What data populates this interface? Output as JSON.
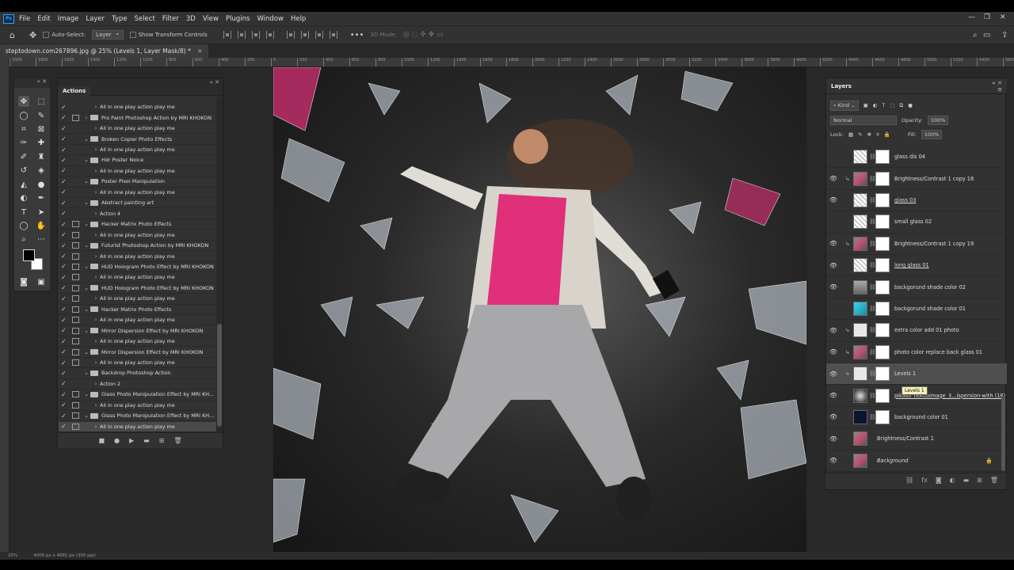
{
  "menubar": {
    "logo": "Ps",
    "items": [
      "File",
      "Edit",
      "Image",
      "Layer",
      "Type",
      "Select",
      "Filter",
      "3D",
      "View",
      "Plugins",
      "Window",
      "Help"
    ],
    "window_controls": [
      "—",
      "❐",
      "✕"
    ]
  },
  "options": {
    "auto_select_label": "Auto-Select:",
    "auto_select_value": "Layer",
    "transform_label": "Show Transform Controls",
    "mode_label": "3D Mode:"
  },
  "document": {
    "tab_title": "steptodown.com267896.jpg @ 25% (Levels 1, Layer Mask/8) *",
    "zoom": "25%",
    "size_info": "4000 px x 4881 px (300 ppi)"
  },
  "ruler_ticks": [
    "2000",
    "1800",
    "1600",
    "1400",
    "1200",
    "1000",
    "800",
    "600",
    "400",
    "200",
    "0",
    "200",
    "400",
    "600",
    "800",
    "1000",
    "1200",
    "1400",
    "1600",
    "1800",
    "2000",
    "2200",
    "2400",
    "2600",
    "2800",
    "3000",
    "3200",
    "3400",
    "3600",
    "3800",
    "4000",
    "4200",
    "4400",
    "4600",
    "4800",
    "5000",
    "5200",
    "5400",
    "5600",
    "5800",
    "6000"
  ],
  "actions_panel": {
    "tab_label": "Actions",
    "rows": [
      {
        "check": true,
        "dialog": false,
        "arrow": "›",
        "folder": false,
        "indent": true,
        "label": "All in one play action play me"
      },
      {
        "check": true,
        "dialog": true,
        "arrow": "›",
        "folder": true,
        "indent": false,
        "label": "Pro Paint Photoshop Action by MRI KHOKON"
      },
      {
        "check": true,
        "dialog": false,
        "arrow": "›",
        "folder": false,
        "indent": true,
        "label": "All in one play action play me"
      },
      {
        "check": true,
        "dialog": false,
        "arrow": "⌄",
        "folder": true,
        "indent": false,
        "label": "Broken Copier Photo Effects"
      },
      {
        "check": true,
        "dialog": false,
        "arrow": "›",
        "folder": false,
        "indent": true,
        "label": "All in one play action play me"
      },
      {
        "check": true,
        "dialog": false,
        "arrow": "⌄",
        "folder": true,
        "indent": false,
        "label": "Hdr Poster Noice"
      },
      {
        "check": true,
        "dialog": false,
        "arrow": "›",
        "folder": false,
        "indent": true,
        "label": "All in one play action play me"
      },
      {
        "check": true,
        "dialog": false,
        "arrow": "⌄",
        "folder": true,
        "indent": false,
        "label": "Poster Pixel Manipulation"
      },
      {
        "check": true,
        "dialog": false,
        "arrow": "›",
        "folder": false,
        "indent": true,
        "label": "All in one play action play me"
      },
      {
        "check": true,
        "dialog": false,
        "arrow": "⌄",
        "folder": true,
        "indent": false,
        "label": "Abstract painting art"
      },
      {
        "check": true,
        "dialog": false,
        "arrow": "›",
        "folder": false,
        "indent": true,
        "label": "Action 4"
      },
      {
        "check": true,
        "dialog": true,
        "arrow": "⌄",
        "folder": true,
        "indent": false,
        "label": "Hacker Matrix Photo Effects"
      },
      {
        "check": true,
        "dialog": true,
        "arrow": "›",
        "folder": false,
        "indent": true,
        "label": "All in one play action play me"
      },
      {
        "check": true,
        "dialog": true,
        "arrow": "⌄",
        "folder": true,
        "indent": false,
        "label": "Futurist Photoshop Action by MRI KHOKON"
      },
      {
        "check": true,
        "dialog": true,
        "arrow": "›",
        "folder": false,
        "indent": true,
        "label": "All in one play action play me"
      },
      {
        "check": true,
        "dialog": true,
        "arrow": "⌄",
        "folder": true,
        "indent": false,
        "label": "HUD Hologram Photo Effect by MRI KHOKON"
      },
      {
        "check": true,
        "dialog": true,
        "arrow": "›",
        "folder": false,
        "indent": true,
        "label": "All in one play action play me"
      },
      {
        "check": true,
        "dialog": true,
        "arrow": "⌄",
        "folder": true,
        "indent": false,
        "label": "HUD Hologram Photo Effect by MRI KHOKON"
      },
      {
        "check": true,
        "dialog": true,
        "arrow": "›",
        "folder": false,
        "indent": true,
        "label": "All in one play action play me"
      },
      {
        "check": true,
        "dialog": true,
        "arrow": "⌄",
        "folder": true,
        "indent": false,
        "label": "Hacker Matrix Photo Effects"
      },
      {
        "check": true,
        "dialog": true,
        "arrow": "›",
        "folder": false,
        "indent": true,
        "label": "All in one play action play me"
      },
      {
        "check": true,
        "dialog": true,
        "arrow": "⌄",
        "folder": true,
        "indent": false,
        "label": "Mirror Dispersion Effect by MRI KHOKON"
      },
      {
        "check": true,
        "dialog": true,
        "arrow": "›",
        "folder": false,
        "indent": true,
        "label": "All in one play action play me"
      },
      {
        "check": true,
        "dialog": true,
        "arrow": "⌄",
        "folder": true,
        "indent": false,
        "label": "Mirror Dispersion Effect by MRI KHOKON"
      },
      {
        "check": true,
        "dialog": true,
        "arrow": "›",
        "folder": false,
        "indent": true,
        "label": "All in one play action play me"
      },
      {
        "check": true,
        "dialog": false,
        "arrow": "⌄",
        "folder": true,
        "indent": false,
        "label": "Backdrop Photoshop Action"
      },
      {
        "check": true,
        "dialog": false,
        "arrow": "›",
        "folder": false,
        "indent": true,
        "label": "Action 2"
      },
      {
        "check": true,
        "dialog": true,
        "arrow": "⌄",
        "folder": true,
        "indent": false,
        "label": "Glass Photo Manipulation Effect by MRI KH..."
      },
      {
        "check": true,
        "dialog": true,
        "arrow": "›",
        "folder": false,
        "indent": true,
        "label": "All in one play action play me"
      },
      {
        "check": true,
        "dialog": true,
        "arrow": "⌄",
        "folder": true,
        "indent": false,
        "label": "Glass Photo Manipulation Effect by MRI KH..."
      },
      {
        "check": true,
        "dialog": true,
        "arrow": "›",
        "folder": false,
        "indent": true,
        "label": "All in one play action play me",
        "selected": true
      }
    ],
    "footer_icons": [
      "stop-icon",
      "record-icon",
      "play-icon",
      "folder-icon",
      "new-icon",
      "trash-icon"
    ]
  },
  "layers_panel": {
    "tab_label": "Layers",
    "filter_label": "Kind",
    "blend_mode": "Normal",
    "opacity_label": "Opacity:",
    "opacity_value": "100%",
    "lock_label": "Lock:",
    "fill_label": "Fill:",
    "fill_value": "100%",
    "rows": [
      {
        "visible": false,
        "thumb": "checker",
        "clip": false,
        "mask": true,
        "name": "glass dis 04",
        "style": ""
      },
      {
        "visible": true,
        "thumb": "photo",
        "clip": true,
        "mask": true,
        "name": "Brightness/Contrast 1 copy 18",
        "style": ""
      },
      {
        "visible": true,
        "thumb": "checker",
        "clip": false,
        "mask": true,
        "name": "glass 03",
        "style": "under"
      },
      {
        "visible": false,
        "thumb": "checker",
        "clip": false,
        "mask": true,
        "name": "small glass 02",
        "style": ""
      },
      {
        "visible": true,
        "thumb": "photo",
        "clip": true,
        "mask": true,
        "name": "Brightness/Contrast 1 copy 19",
        "style": ""
      },
      {
        "visible": true,
        "thumb": "checker",
        "clip": false,
        "mask": true,
        "name": "long glass 01",
        "style": "under"
      },
      {
        "visible": true,
        "thumb": "grey",
        "clip": false,
        "mask": true,
        "name": "backgorund shade color 02",
        "style": ""
      },
      {
        "visible": false,
        "thumb": "cyan",
        "clip": false,
        "mask": true,
        "name": "backgorund shade  color 01",
        "style": ""
      },
      {
        "visible": true,
        "thumb": "adj",
        "clip": true,
        "mask": true,
        "name": "extra color add 01 photo",
        "style": ""
      },
      {
        "visible": true,
        "thumb": "photo",
        "clip": true,
        "mask": true,
        "name": "photo color replace  back glass 01",
        "style": ""
      },
      {
        "visible": true,
        "thumb": "adj",
        "clip": true,
        "mask": true,
        "name": "Levels 1",
        "style": "",
        "selected": true
      },
      {
        "visible": true,
        "thumb": "dust",
        "clip": false,
        "mask": true,
        "name": "pikaso_texttoimage_3...ispersion-with (18)",
        "style": "under"
      },
      {
        "visible": true,
        "thumb": "dark",
        "clip": false,
        "mask": true,
        "name": "background color 01",
        "style": ""
      },
      {
        "visible": true,
        "thumb": "photo",
        "clip": false,
        "mask": false,
        "name": "Brightness/Contrast 1",
        "style": ""
      },
      {
        "visible": true,
        "thumb": "photo",
        "clip": false,
        "mask": false,
        "name": "Background",
        "style": "ital",
        "locked": true
      }
    ],
    "tooltip": "Levels 1",
    "footer_icons": [
      "link-icon",
      "fx-icon",
      "mask-icon",
      "adjustment-icon",
      "group-icon",
      "new-layer-icon",
      "trash-icon"
    ]
  },
  "colors": {
    "ui_bg": "#323232",
    "ui_dark": "#282828",
    "accent": "#2ea3f2",
    "tank_top_pink": "#e0307a"
  }
}
